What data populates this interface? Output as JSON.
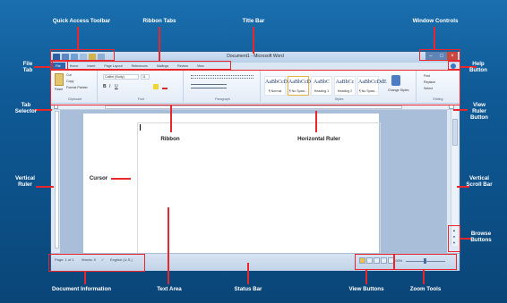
{
  "window": {
    "title": "Document1 - Microsoft Word"
  },
  "ribbon_tabs": [
    "File",
    "Home",
    "Insert",
    "Page Layout",
    "References",
    "Mailings",
    "Review",
    "View"
  ],
  "ribbon": {
    "clipboard": {
      "paste": "Paste",
      "cut": "Cut",
      "copy": "Copy",
      "format_painter": "Format Painter",
      "group": "Clipboard"
    },
    "font": {
      "name": "Calibri (Body)",
      "size": "11",
      "group": "Font"
    },
    "paragraph": {
      "group": "Paragraph"
    },
    "styles": {
      "items": [
        {
          "preview": "AaBbCcDd",
          "name": "¶ Normal"
        },
        {
          "preview": "AaBbCcDd",
          "name": "¶ No Spaci..."
        },
        {
          "preview": "AaBbC",
          "name": "Heading 1"
        },
        {
          "preview": "AaBbCc",
          "name": "Heading 2"
        },
        {
          "preview": "AaBbCcDdE",
          "name": "¶ No Spaci..."
        }
      ],
      "change_styles": "Change Styles",
      "group": "Styles"
    },
    "editing": {
      "find": "Find",
      "replace": "Replace",
      "select": "Select",
      "group": "Editing"
    }
  },
  "status": {
    "page": "Page: 1 of 1",
    "words": "Words: 0",
    "language": "English (U.S.)",
    "zoom": "100%"
  },
  "callouts": {
    "quick_access_toolbar": "Quick Access Toolbar",
    "ribbon_tabs": "Ribbon Tabs",
    "title_bar": "Title Bar",
    "window_controls": "Window Controls",
    "file_tab": "File Tab",
    "help_button": "Help Button",
    "tab_selector": "Tab Selector",
    "view_ruler_button": "View Ruler Button",
    "ribbon": "Ribbon",
    "horizontal_ruler": "Horizontal Ruler",
    "vertical_ruler": "Vertical Ruler",
    "cursor": "Cursor",
    "vertical_scroll_bar": "Vertical Scroll Bar",
    "browse_buttons": "Browse Buttons",
    "document_information": "Document Information",
    "text_area": "Text Area",
    "status_bar": "Status Bar",
    "view_buttons": "View Buttons",
    "zoom_tools": "Zoom Tools"
  },
  "colors": {
    "callout": "#e8262b",
    "background": "#0f5a97",
    "file_tab": "#2b67b1"
  }
}
